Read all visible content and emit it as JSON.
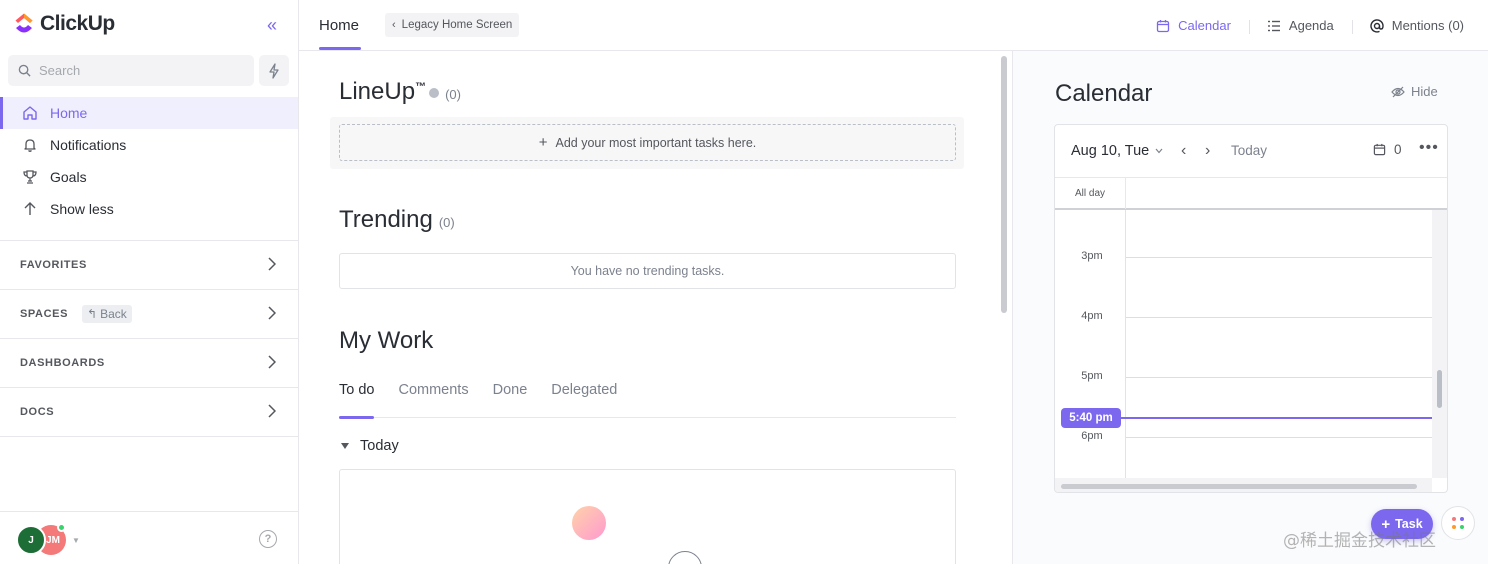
{
  "app": {
    "name": "ClickUp"
  },
  "sidebar": {
    "search_placeholder": "Search",
    "nav": [
      {
        "label": "Home",
        "icon": "home-icon",
        "active": true
      },
      {
        "label": "Notifications",
        "icon": "bell-icon"
      },
      {
        "label": "Goals",
        "icon": "trophy-icon"
      },
      {
        "label": "Show less",
        "icon": "arrow-up-icon"
      }
    ],
    "sections": {
      "favorites": "FAVORITES",
      "spaces": "SPACES",
      "spaces_back": "Back",
      "dashboards": "DASHBOARDS",
      "docs": "DOCS"
    },
    "footer": {
      "avatar_1": "J",
      "avatar_2": "JM"
    }
  },
  "topbar": {
    "home_tab": "Home",
    "legacy_button": "Legacy Home Screen",
    "calendar": "Calendar",
    "agenda": "Agenda",
    "mentions": "Mentions (0)"
  },
  "main": {
    "lineup": {
      "title": "LineUp",
      "tm": "™",
      "count": "(0)",
      "add_text": "Add your most important tasks here."
    },
    "trending": {
      "title": "Trending",
      "count": "(0)",
      "empty_text": "You have no trending tasks."
    },
    "my_work": {
      "title": "My Work",
      "tabs": [
        "To do",
        "Comments",
        "Done",
        "Delegated"
      ],
      "active_tab": "To do",
      "group": "Today"
    }
  },
  "calendar_panel": {
    "title": "Calendar",
    "hide": "Hide",
    "date": "Aug 10, Tue",
    "today": "Today",
    "count": "0",
    "all_day": "All day",
    "hours": [
      "3pm",
      "4pm",
      "5pm",
      "6pm"
    ],
    "now": "5:40 pm"
  },
  "fab": {
    "task": "Task"
  },
  "watermark": "@稀土掘金技术社区",
  "colors": {
    "accent": "#7b68ee",
    "online": "#3ad26c",
    "avatar_j": "#1d6e36",
    "avatar_jm": "#f47a7a"
  }
}
